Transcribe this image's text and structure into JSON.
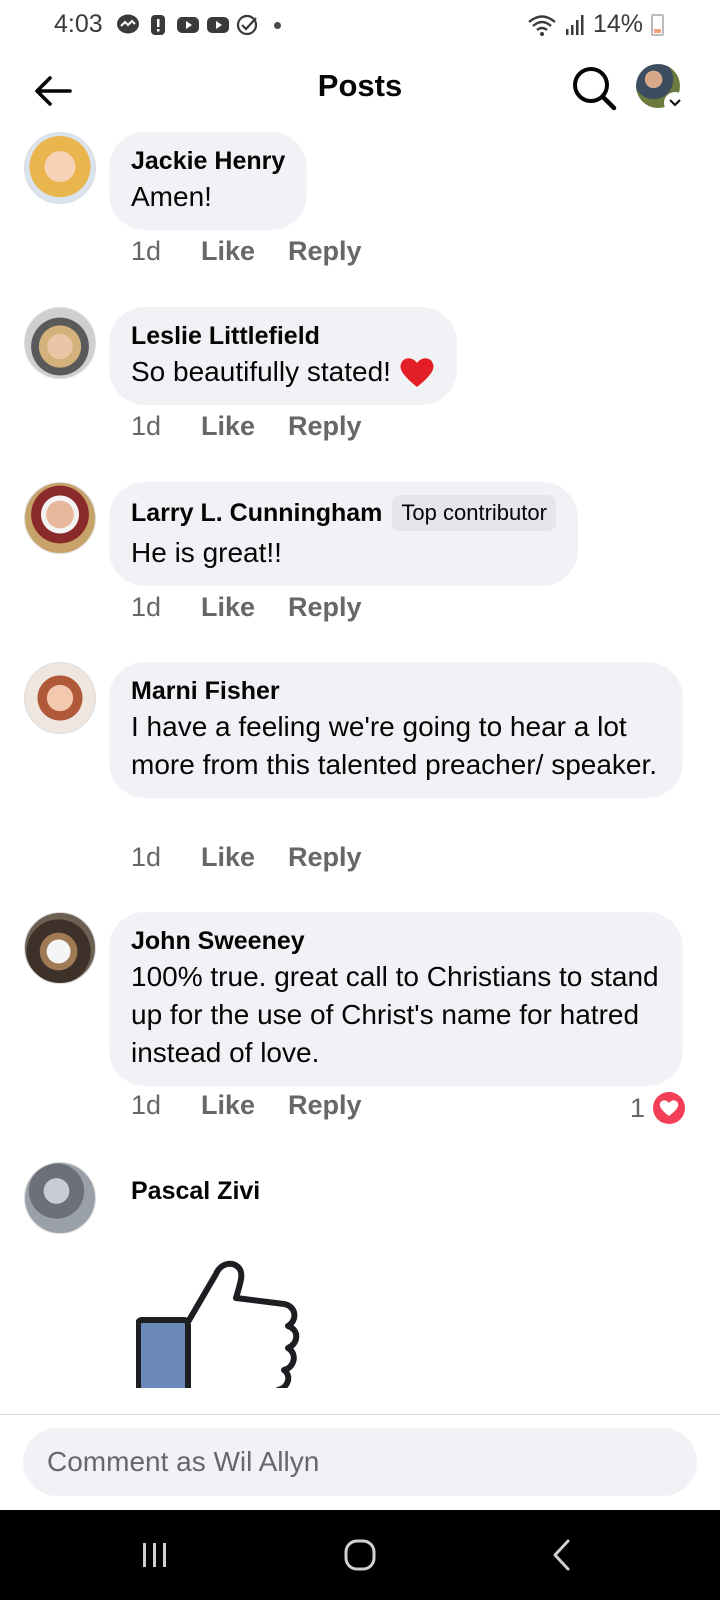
{
  "status_bar": {
    "time": "4:03",
    "battery": "14%",
    "icons": [
      "messenger-icon",
      "alert-icon",
      "youtube-icon",
      "youtube-icon",
      "check-circle-icon",
      "dot-icon",
      "wifi-icon",
      "signal-icon",
      "battery-icon"
    ]
  },
  "header": {
    "title": "Posts",
    "back_icon": "back-arrow-icon",
    "search_icon": "search-icon"
  },
  "comments": [
    {
      "author": "Jackie Henry",
      "text": "Amen!",
      "time": "1d",
      "like": "Like",
      "reply": "Reply"
    },
    {
      "author": "Leslie Littlefield",
      "text": "So beautifully stated!",
      "time": "1d",
      "like": "Like",
      "reply": "Reply",
      "emoji": "heart"
    },
    {
      "author": "Larry L. Cunningham",
      "badge": "Top contributor",
      "text": "He is great!!",
      "time": "1d",
      "like": "Like",
      "reply": "Reply"
    },
    {
      "author": "Marni Fisher",
      "text": "I have a feeling we're going to hear a lot more from this talented preacher/ speaker.",
      "time": "1d",
      "like": "Like",
      "reply": "Reply"
    },
    {
      "author": "John Sweeney",
      "text": "100% true. great call to Christians to stand up for the use of Christ's name for hatred instead of love.",
      "time": "1d",
      "like": "Like",
      "reply": "Reply",
      "reaction_count": "1"
    },
    {
      "author": "Pascal Zivi",
      "sticker": "thumbs-up"
    }
  ],
  "composer": {
    "placeholder": "Comment as Wil Allyn"
  },
  "colors": {
    "bubble": "#f0f2f5",
    "secondary_text": "#65676b",
    "heart": "#f33e58"
  }
}
